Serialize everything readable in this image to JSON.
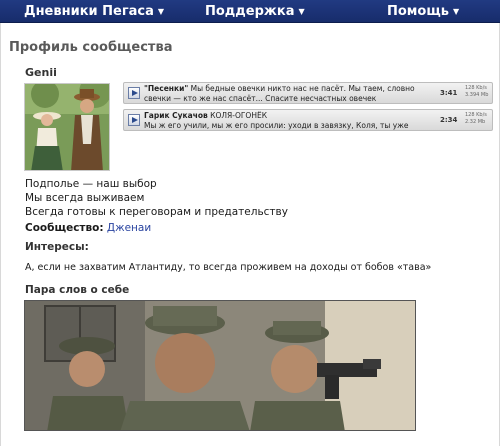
{
  "nav": {
    "items": [
      {
        "label": "Дневники Пегаса",
        "icon": "chevron-down-icon"
      },
      {
        "label": "Поддержка",
        "icon": "chevron-down-icon"
      },
      {
        "label": "Помощь",
        "icon": "chevron-down-icon"
      }
    ],
    "chevron_glyph": "▼",
    "bg_color": "#1c3476"
  },
  "page": {
    "title": "Профиль сообщества"
  },
  "profile": {
    "username": "Genii",
    "avatar_icon": "photo-couple-avatar",
    "players": [
      {
        "artist": "\"Песенки\"",
        "title": "",
        "text": "Мы бедные овечки никто нас не пасёт. Мы таем, словно свечки — кто же нас спасёт... Спасите несчастных овечек",
        "time": "3:41",
        "bitrate": "128 Kb/s",
        "size": "3.394 Mb"
      },
      {
        "artist": "Гарик Сукачов",
        "title": "КОЛЯ-ОГОНЁК",
        "text": "Мы ж его учили, мы ж его просили: уходи в завязку, Коля, ты уже дедок",
        "time": "2:34",
        "bitrate": "128 Kb/s",
        "size": "2.32 Mb"
      }
    ],
    "motto": [
      "Подполье — наш выбор",
      "Мы всегда выживаем",
      "Всегда готовы к переговорам и предательству"
    ],
    "community_label": "Сообщество:",
    "community_value": "Дженаи",
    "interests_heading": "Интересы:",
    "interests_text": "А, если не захватим Атлантиду, то всегда проживем на доходы от бобов «тава»",
    "about_heading": "Пара слов о себе",
    "about_image": "photo-soldiers-with-pistol"
  }
}
